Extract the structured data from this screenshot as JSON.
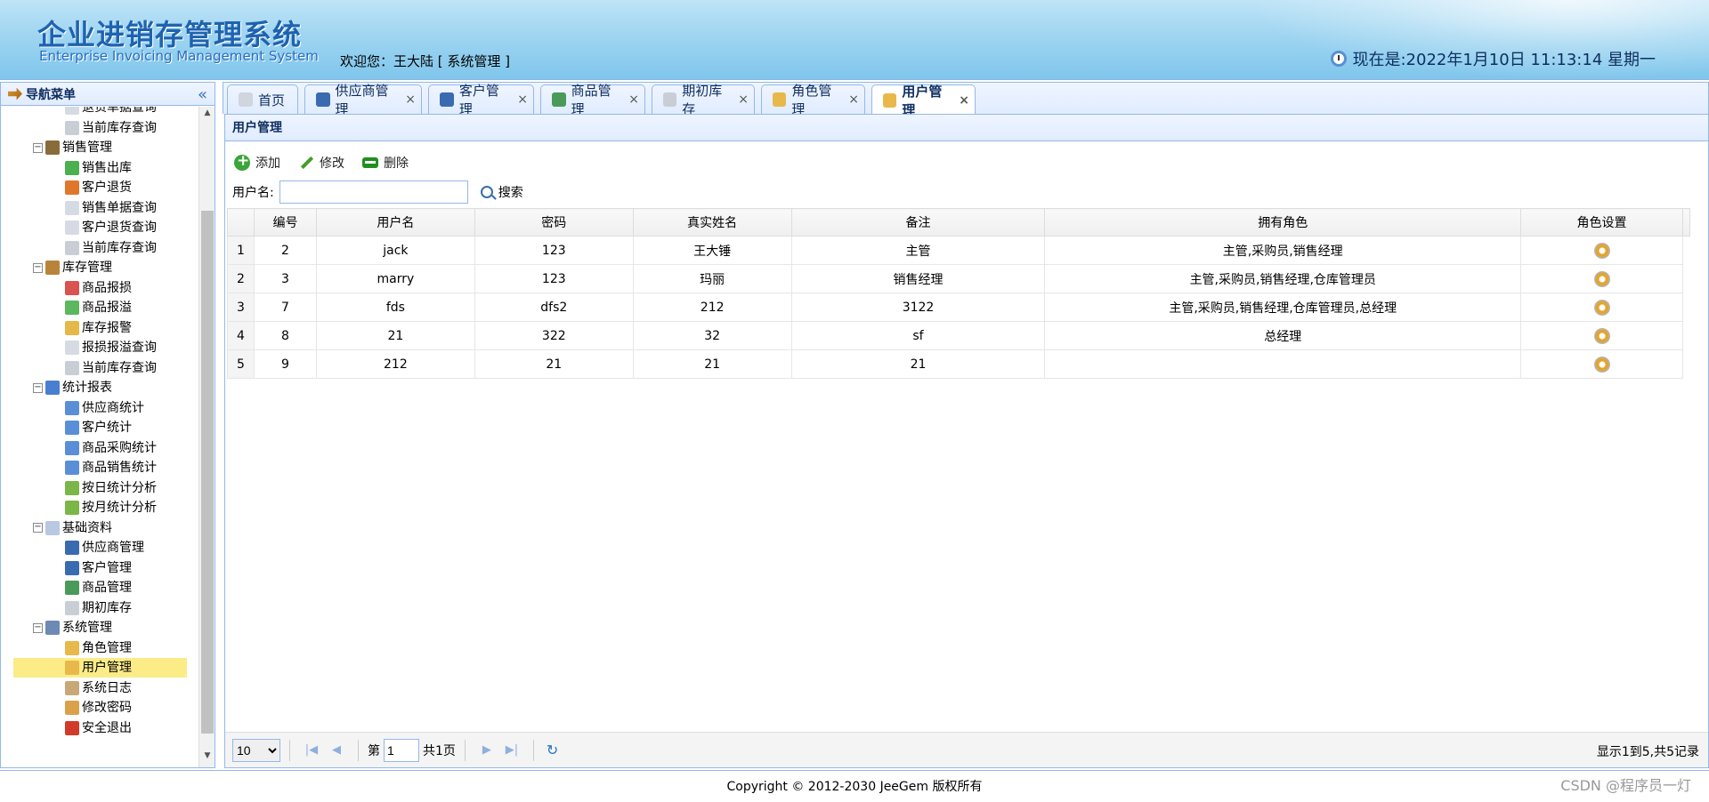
{
  "header": {
    "title": "企业进销存管理系统",
    "subtitle": "Enterprise Invoicing Management System",
    "welcome": "欢迎您：王大陆 [ 系统管理 ]",
    "clock": "现在是:2022年1月10日 11:13:14 星期一"
  },
  "sidebar": {
    "title": "导航菜单",
    "items": [
      {
        "label": "退货单据查询",
        "level": 2,
        "icon": "search-doc-icon"
      },
      {
        "label": "当前库存查询",
        "level": 2,
        "icon": "db-icon"
      },
      {
        "label": "销售管理",
        "level": 1,
        "icon": "sale-icon"
      },
      {
        "label": "销售出库",
        "level": 2,
        "icon": "arrow-right-icon"
      },
      {
        "label": "客户退货",
        "level": 2,
        "icon": "arrow-left-icon"
      },
      {
        "label": "销售单据查询",
        "level": 2,
        "icon": "search-doc-icon"
      },
      {
        "label": "客户退货查询",
        "level": 2,
        "icon": "search-doc-icon"
      },
      {
        "label": "当前库存查询",
        "level": 2,
        "icon": "db-icon"
      },
      {
        "label": "库存管理",
        "level": 1,
        "icon": "box-icon"
      },
      {
        "label": "商品报损",
        "level": 2,
        "icon": "damage-icon"
      },
      {
        "label": "商品报溢",
        "level": 2,
        "icon": "overflow-icon"
      },
      {
        "label": "库存报警",
        "level": 2,
        "icon": "alarm-icon"
      },
      {
        "label": "报损报溢查询",
        "level": 2,
        "icon": "search-doc-icon"
      },
      {
        "label": "当前库存查询",
        "level": 2,
        "icon": "db-icon"
      },
      {
        "label": "统计报表",
        "level": 1,
        "icon": "chart-icon"
      },
      {
        "label": "供应商统计",
        "level": 2,
        "icon": "bar-chart-icon"
      },
      {
        "label": "客户统计",
        "level": 2,
        "icon": "bar-chart-icon"
      },
      {
        "label": "商品采购统计",
        "level": 2,
        "icon": "bar-chart-icon"
      },
      {
        "label": "商品销售统计",
        "level": 2,
        "icon": "bar-chart-icon"
      },
      {
        "label": "按日统计分析",
        "level": 2,
        "icon": "day-chart-icon"
      },
      {
        "label": "按月统计分析",
        "level": 2,
        "icon": "month-chart-icon"
      },
      {
        "label": "基础资料",
        "level": 1,
        "icon": "base-data-icon"
      },
      {
        "label": "供应商管理",
        "level": 2,
        "icon": "user-icon"
      },
      {
        "label": "客户管理",
        "level": 2,
        "icon": "user-icon"
      },
      {
        "label": "商品管理",
        "level": 2,
        "icon": "goods-icon"
      },
      {
        "label": "期初库存",
        "level": 2,
        "icon": "db-icon"
      },
      {
        "label": "系统管理",
        "level": 1,
        "icon": "computer-icon"
      },
      {
        "label": "角色管理",
        "level": 2,
        "icon": "role-icon"
      },
      {
        "label": "用户管理",
        "level": 2,
        "icon": "users-icon",
        "selected": true
      },
      {
        "label": "系统日志",
        "level": 2,
        "icon": "log-icon"
      },
      {
        "label": "修改密码",
        "level": 2,
        "icon": "lock-icon"
      },
      {
        "label": "安全退出",
        "level": 2,
        "icon": "exit-icon"
      }
    ]
  },
  "tabs": [
    {
      "label": "首页",
      "icon": "home-doc-icon",
      "closable": false
    },
    {
      "label": "供应商管理",
      "icon": "user-icon",
      "closable": true
    },
    {
      "label": "客户管理",
      "icon": "user-icon",
      "closable": true
    },
    {
      "label": "商品管理",
      "icon": "goods-icon",
      "closable": true
    },
    {
      "label": "期初库存",
      "icon": "db-icon",
      "closable": true
    },
    {
      "label": "角色管理",
      "icon": "role-icon",
      "closable": true
    },
    {
      "label": "用户管理",
      "icon": "users-icon",
      "closable": true,
      "active": true
    }
  ],
  "panel": {
    "title": "用户管理",
    "toolbar": {
      "add": "添加",
      "edit": "修改",
      "delete": "删除"
    },
    "search": {
      "label": "用户名:",
      "value": "",
      "button": "搜索"
    }
  },
  "grid": {
    "columns": [
      "编号",
      "用户名",
      "密码",
      "真实姓名",
      "备注",
      "拥有角色",
      "角色设置"
    ],
    "rows": [
      {
        "rownum": "1",
        "id": "2",
        "username": "jack",
        "password": "123",
        "realname": "王大锤",
        "remark": "主管",
        "roles": "主管,采购员,销售经理"
      },
      {
        "rownum": "2",
        "id": "3",
        "username": "marry",
        "password": "123",
        "realname": "玛丽",
        "remark": "销售经理",
        "roles": "主管,采购员,销售经理,仓库管理员"
      },
      {
        "rownum": "3",
        "id": "7",
        "username": "fds",
        "password": "dfs2",
        "realname": "212",
        "remark": "3122",
        "roles": "主管,采购员,销售经理,仓库管理员,总经理"
      },
      {
        "rownum": "4",
        "id": "8",
        "username": "21",
        "password": "322",
        "realname": "32",
        "remark": "sf",
        "roles": "总经理"
      },
      {
        "rownum": "5",
        "id": "9",
        "username": "212",
        "password": "21",
        "realname": "21",
        "remark": "21",
        "roles": ""
      }
    ]
  },
  "pager": {
    "page_size": "10",
    "page_prefix": "第",
    "page_value": "1",
    "page_total": "共1页",
    "info": "显示1到5,共5记录"
  },
  "footer": {
    "copyright": "Copyright © 2012-2030 JeeGem 版权所有",
    "watermark": "CSDN @程序员一灯"
  },
  "colors": {
    "accent": "#95b8e7",
    "header_blue": "#7fc6ec",
    "selected_row": "#fbec88"
  }
}
